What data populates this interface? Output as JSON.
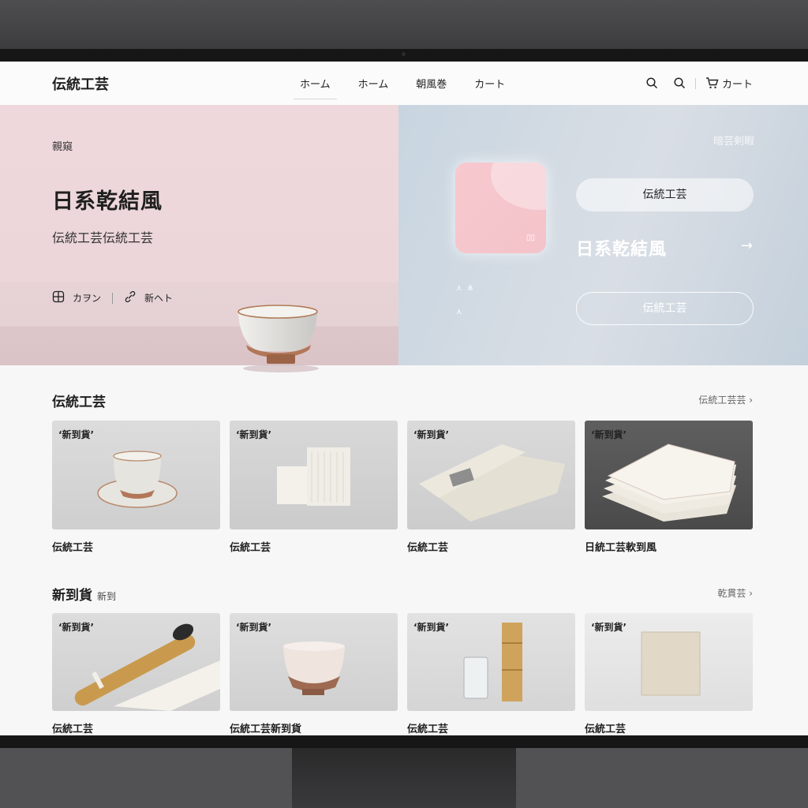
{
  "header": {
    "logo": "伝統工芸",
    "nav": [
      "ホーム",
      "ホーム",
      "朝風巻",
      "カート"
    ],
    "cart_label": "カート"
  },
  "hero": {
    "eyebrow": "親窺",
    "title": "日系乾結風",
    "subtitle": "伝統工芸伝統工芸",
    "action1": "カヲン",
    "action2": "新ヘト",
    "right": {
      "top_label": "暗芸剣暇",
      "pill_label": "伝統工芸",
      "link_label": "日系乾結風",
      "outline_label": "伝統工芸"
    }
  },
  "section1": {
    "heading": "伝統工芸",
    "more": "伝統工芸芸",
    "items": [
      {
        "badge": "‘新到貨’",
        "title": "伝統工芸"
      },
      {
        "badge": "‘新到貨’",
        "title": "伝統工芸"
      },
      {
        "badge": "‘新到貨’",
        "title": "伝統工芸"
      },
      {
        "badge": "‘新到貨’",
        "title": "日統工芸軟到風"
      }
    ]
  },
  "section2": {
    "heading": "新到貨",
    "heading_sub": "新到",
    "more": "乾貫芸",
    "items": [
      {
        "badge": "‘新到貨’",
        "title": "伝統工芸"
      },
      {
        "badge": "‘新到貨’",
        "title": "伝統工芸新到貨"
      },
      {
        "badge": "‘新到貨’",
        "title": "伝統工芸"
      },
      {
        "badge": "‘新到貨’",
        "title": "伝統工芸"
      }
    ]
  }
}
